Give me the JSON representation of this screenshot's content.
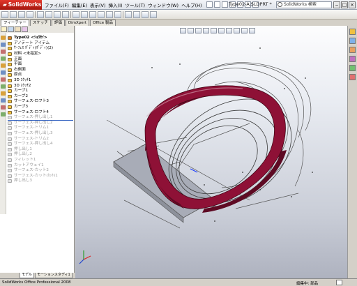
{
  "app": {
    "brand": "SolidWorks",
    "doc_name": "Type02-A.SLDPRT *"
  },
  "menu": [
    "ファイル(F)",
    "編集(E)",
    "表示(V)",
    "挿入(I)",
    "ツール(T)",
    "ウィンドウ(W)",
    "ヘルプ(H)"
  ],
  "search": {
    "placeholder": "SolidWorks 検索"
  },
  "command_tabs": [
    "フィーチャー",
    "スケッチ",
    "評価",
    "DimXpert",
    "Office 製品"
  ],
  "tree": {
    "root": "Type02 <ｼｮｳｾｲ>",
    "items": [
      "アノテート アイテム",
      "ｻｰﾌｪｽ ﾎﾞﾃﾞｨ(ﾎﾞﾃﾞｨ)(2)",
      "材料 <未指定>",
      "正面",
      "平面",
      "右側面",
      "原点",
      "3D ｽｹｯﾁ1",
      "3D ｽｹｯﾁ2",
      "カーブ1",
      "カーブ2",
      "サーフェス-ロフト3",
      "カーブ3",
      "サーフェス-ロフト4"
    ],
    "dim_items": [
      "サーフェス-押し出し1",
      "サーフェス-押し出し2",
      "サーフェス-トリム1",
      "サーフェス-押し出し3",
      "サーフェス-トリム2",
      "サーフェス-押し出し4",
      "押し出し1",
      "押し出し2",
      "フィレット1",
      "カットアウェイ1",
      "サーフェス-カット2",
      "サーフェス-カット(ｶｯﾄ)1",
      "押し出し3"
    ]
  },
  "bottom_tabs": [
    "モデル",
    "モーションスタディ1"
  ],
  "status": {
    "left": "SolidWorks Office Professional 2008",
    "mode": "編集中: 部品"
  },
  "colors": {
    "ring_outer": "#8e1136",
    "ring_inner": "#5e0a23",
    "brand_red": "#c0221a"
  }
}
